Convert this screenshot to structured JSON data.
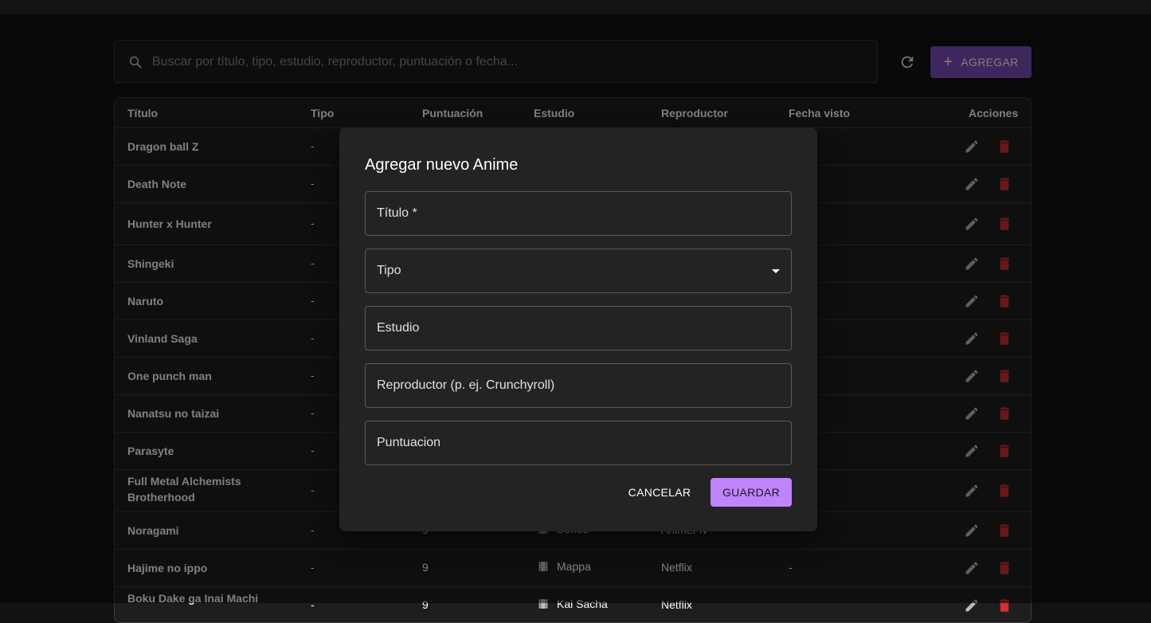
{
  "search": {
    "placeholder": "Buscar por título, tipo, estudio, reproductor, puntuación o fecha..."
  },
  "toolbar": {
    "add_label": "AGREGAR",
    "refresh_icon": "refresh-icon"
  },
  "table": {
    "headers": [
      "Título",
      "Tipo",
      "Puntuación",
      "Estudio",
      "Reproductor",
      "Fecha visto",
      "Acciones"
    ],
    "rows": [
      {
        "title": "Dragon ball Z",
        "tipo": "-",
        "punt": "",
        "estudio": "",
        "rep": "",
        "fecha": ""
      },
      {
        "title": "Death Note",
        "tipo": "-",
        "punt": "",
        "estudio": "",
        "rep": "",
        "fecha": ""
      },
      {
        "title": "Hunter x Hunter",
        "tipo": "-",
        "punt": "",
        "estudio": "",
        "rep": "",
        "fecha": ""
      },
      {
        "title": "Shingeki",
        "tipo": "-",
        "punt": "",
        "estudio": "",
        "rep": "",
        "fecha": ""
      },
      {
        "title": "Naruto",
        "tipo": "-",
        "punt": "",
        "estudio": "",
        "rep": "",
        "fecha": ""
      },
      {
        "title": "Vinland Saga",
        "tipo": "-",
        "punt": "",
        "estudio": "",
        "rep": "",
        "fecha": ""
      },
      {
        "title": "One punch man",
        "tipo": "-",
        "punt": "",
        "estudio": "",
        "rep": "",
        "fecha": ""
      },
      {
        "title": "Nanatsu no taizai",
        "tipo": "-",
        "punt": "",
        "estudio": "",
        "rep": "",
        "fecha": ""
      },
      {
        "title": "Parasyte",
        "tipo": "-",
        "punt": "",
        "estudio": "",
        "rep": "",
        "fecha": ""
      },
      {
        "title": "Full Metal Alchemists Brotherhood",
        "tipo": "-",
        "punt": "",
        "estudio": "",
        "rep": "",
        "fecha": ""
      },
      {
        "title": "Noragami",
        "tipo": "-",
        "punt": "9",
        "estudio": "Bones",
        "rep": "AnimeFlv",
        "fecha": ""
      },
      {
        "title": "Hajime no ippo",
        "tipo": "-",
        "punt": "9",
        "estudio": "Mappa",
        "rep": "Netflix",
        "fecha": "-"
      },
      {
        "title": "Boku Dake ga Inai Machi",
        "tipo": "-",
        "punt": "9",
        "estudio": "Kai Sacha",
        "rep": "Netflix",
        "fecha": ""
      }
    ]
  },
  "dialog": {
    "title": "Agregar nuevo Anime",
    "fields": [
      "Título *",
      "Tipo",
      "Estudio",
      "Reproductor (p. ej. Crunchyroll)",
      "Puntuacion"
    ],
    "cancel_label": "CANCELAR",
    "save_label": "GUARDAR"
  },
  "colors": {
    "accent": "#c084fc",
    "add_button": "#7b4fb8",
    "delete": "#d32f2f",
    "background": "#121212"
  }
}
